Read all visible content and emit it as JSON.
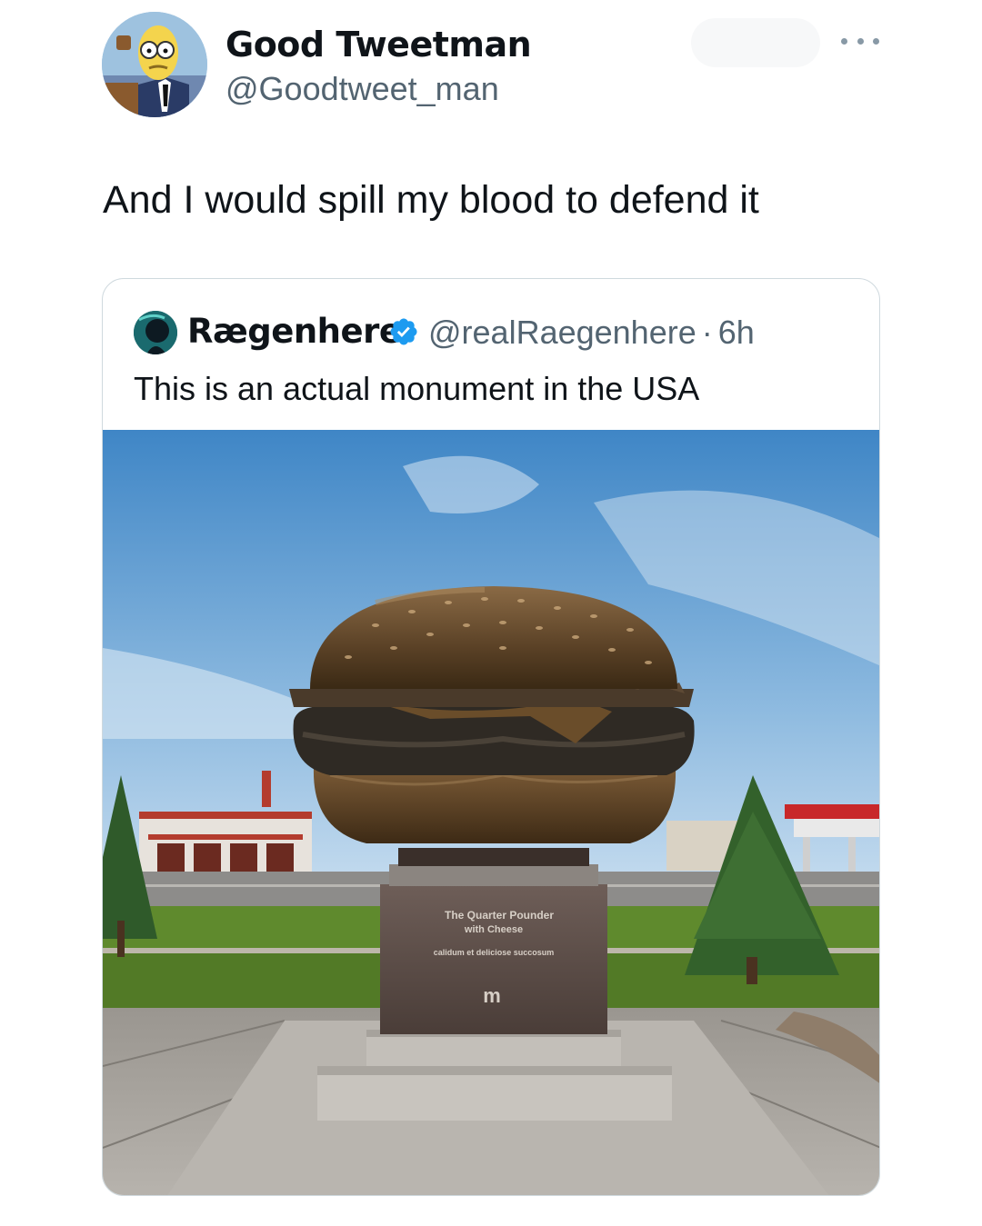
{
  "tweet": {
    "author": {
      "name": "Good Tweetman",
      "handle": "@Goodtweet_man",
      "avatar_icon": "cartoon-character-avatar"
    },
    "more_icon": "more-horizontal-icon",
    "text": "And I would spill my blood to defend it"
  },
  "quoted_tweet": {
    "author": {
      "name": "Rægenhere",
      "handle": "@realRaegenhere",
      "verified": true,
      "verified_icon": "verified-badge-icon",
      "avatar_icon": "profile-avatar"
    },
    "separator": "·",
    "time": "6h",
    "text": "This is an actual monument in the USA",
    "image": {
      "plaque_line1": "The Quarter Pounder",
      "plaque_line2": "with Cheese",
      "plaque_motto": "calidum et deliciose succosum",
      "plaque_logo": "m"
    }
  },
  "colors": {
    "text_primary": "#0f1419",
    "text_secondary": "#536471",
    "verified_blue": "#1d9bf0",
    "border": "#cfd9de"
  }
}
